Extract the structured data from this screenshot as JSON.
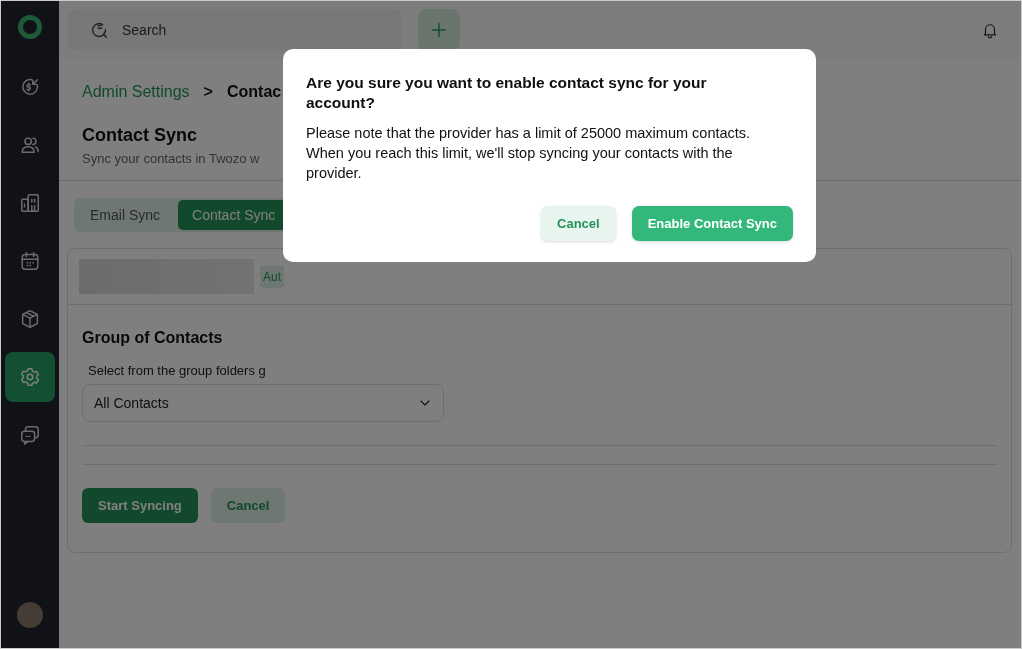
{
  "sidebar": {
    "items": [
      {
        "kind": "deals",
        "selected": false
      },
      {
        "kind": "contacts",
        "selected": false
      },
      {
        "kind": "companies",
        "selected": false
      },
      {
        "kind": "calendar",
        "selected": false
      },
      {
        "kind": "products",
        "selected": false
      },
      {
        "kind": "settings",
        "selected": true
      },
      {
        "kind": "chat",
        "selected": false
      }
    ]
  },
  "topbar": {
    "search": {
      "placeholder": "Search"
    }
  },
  "breadcrumb": {
    "parent": "Admin Settings",
    "separator": ">",
    "current": "Contac"
  },
  "page": {
    "title": "Contact Sync",
    "subtitle": "Sync your contacts in Twozo w"
  },
  "tabs": [
    {
      "label": "Email Sync",
      "selected": false
    },
    {
      "label": "Contact Sync",
      "selected": true
    }
  ],
  "account": {
    "badge": "Aut"
  },
  "group": {
    "heading": "Group of Contacts",
    "label": "Select from the group folders g",
    "value": "All Contacts"
  },
  "actions": [
    {
      "label": "Start Syncing",
      "kind": "primary"
    },
    {
      "label": "Cancel",
      "kind": "secondary"
    }
  ],
  "dialog": {
    "title": "Are you sure you want to enable contact sync for your account?",
    "message": "Please note that the provider has a limit of 25000 maximum contacts. When you reach this limit, we'll stop syncing your contacts with the provider.",
    "buttons": [
      {
        "label": "Cancel",
        "kind": "secondary"
      },
      {
        "label": "Enable Contact Sync",
        "kind": "primary"
      }
    ]
  }
}
